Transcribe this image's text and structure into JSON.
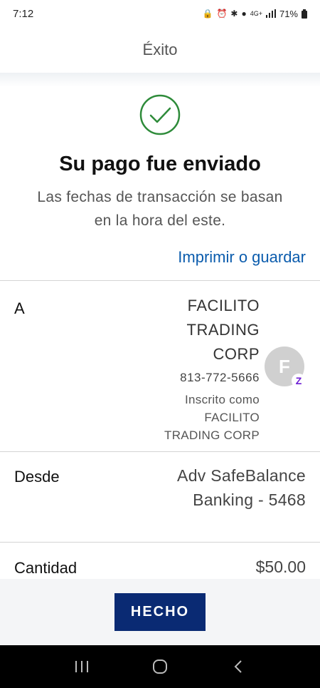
{
  "status_bar": {
    "time": "7:12",
    "network": "4G+",
    "battery": "71%"
  },
  "header": {
    "title": "Éxito"
  },
  "success": {
    "title": "Su pago fue enviado",
    "subtitle_line1": "Las fechas de transacción se basan",
    "subtitle_line2": "en la hora del este.",
    "icon": "check-circle-icon",
    "icon_color": "#2e8b3a"
  },
  "print_link": "Imprimir o guardar",
  "details": {
    "to": {
      "label": "A",
      "name_lines": [
        "FACILITO",
        "TRADING",
        "CORP"
      ],
      "phone": "813-772-5666",
      "enrolled_lines": [
        "Inscrito como",
        "FACILITO",
        "TRADING CORP"
      ],
      "avatar_initial": "F",
      "badge": "Z"
    },
    "from": {
      "label": "Desde",
      "value_line1": "Adv SafeBalance",
      "value_line2": "Banking - 5468"
    },
    "amount": {
      "label": "Cantidad",
      "value": "$50.00"
    }
  },
  "done_button": "HECHO",
  "colors": {
    "link": "#0b5cad",
    "button": "#0a2a73",
    "zelle": "#6d1ed4"
  }
}
